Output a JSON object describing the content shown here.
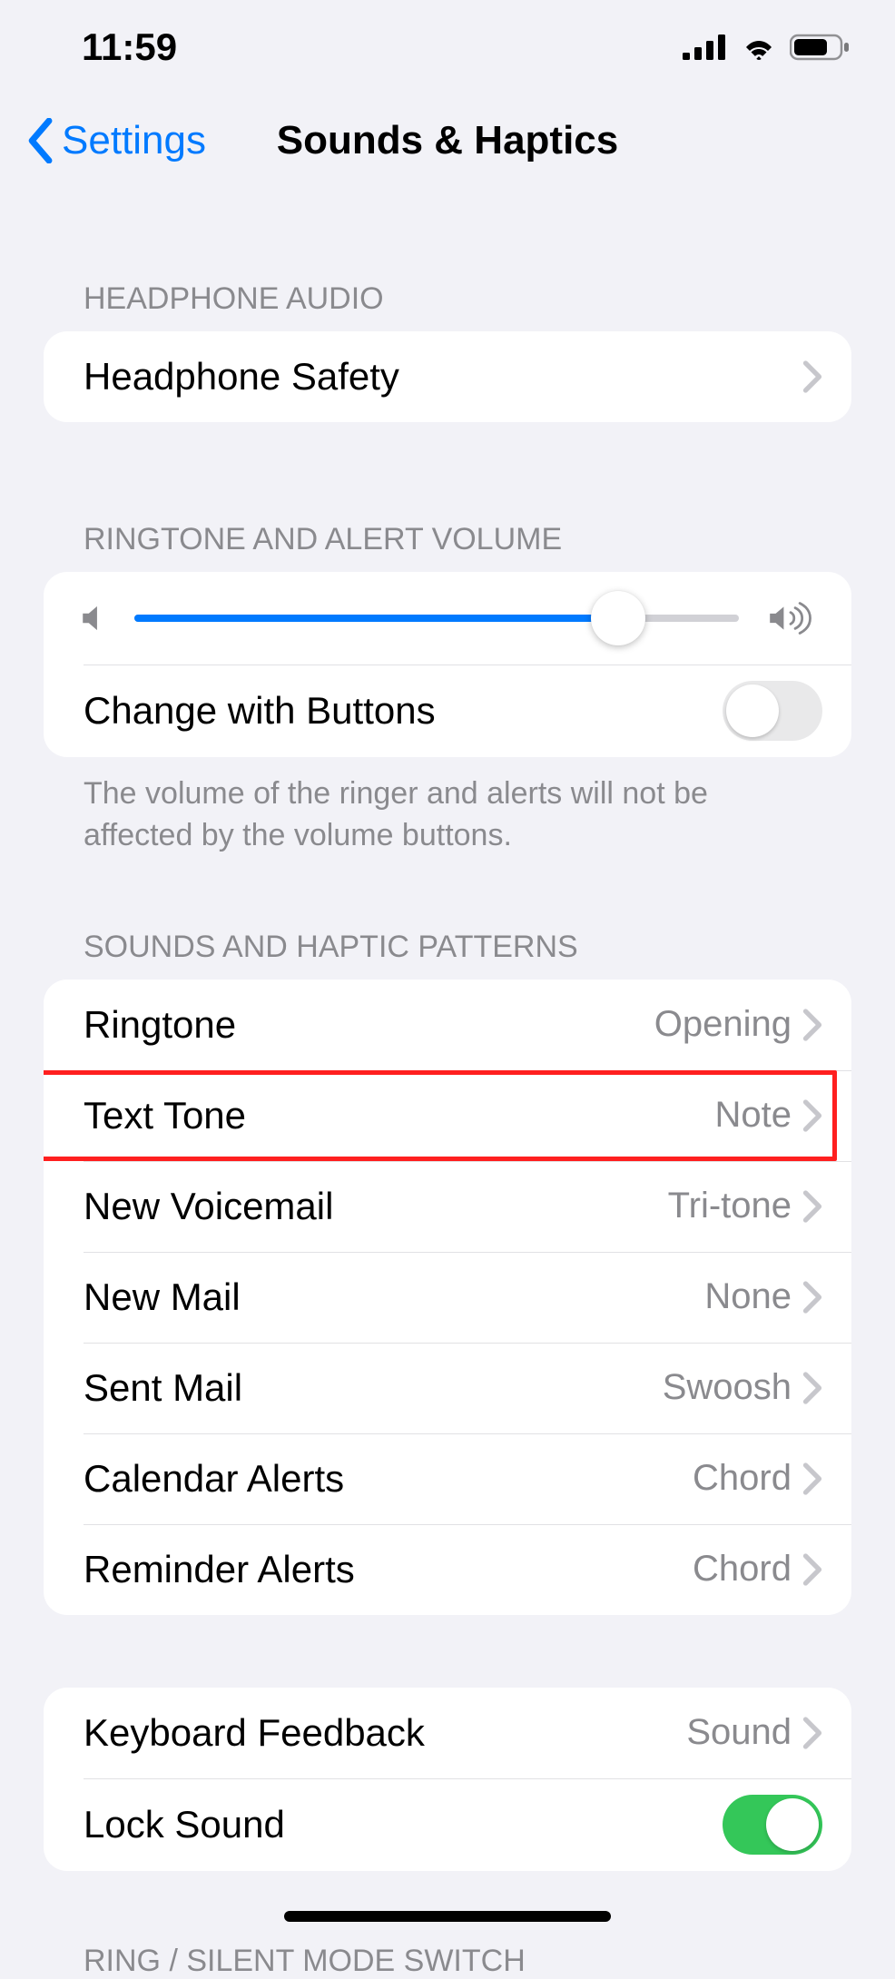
{
  "statusbar": {
    "time": "11:59"
  },
  "nav": {
    "back_label": "Settings",
    "title": "Sounds & Haptics"
  },
  "sections": {
    "headphone": {
      "header": "HEADPHONE AUDIO",
      "safety_label": "Headphone Safety"
    },
    "volume": {
      "header": "RINGTONE AND ALERT VOLUME",
      "slider_percent": 80,
      "change_with_buttons_label": "Change with Buttons",
      "change_with_buttons_on": false,
      "footer": "The volume of the ringer and alerts will not be affected by the volume buttons."
    },
    "patterns": {
      "header": "SOUNDS AND HAPTIC PATTERNS",
      "items": [
        {
          "label": "Ringtone",
          "value": "Opening"
        },
        {
          "label": "Text Tone",
          "value": "Note",
          "highlighted": true
        },
        {
          "label": "New Voicemail",
          "value": "Tri-tone"
        },
        {
          "label": "New Mail",
          "value": "None"
        },
        {
          "label": "Sent Mail",
          "value": "Swoosh"
        },
        {
          "label": "Calendar Alerts",
          "value": "Chord"
        },
        {
          "label": "Reminder Alerts",
          "value": "Chord"
        }
      ]
    },
    "feedback": {
      "keyboard_label": "Keyboard Feedback",
      "keyboard_value": "Sound",
      "lock_label": "Lock Sound",
      "lock_on": true
    },
    "ring_silent": {
      "header": "RING / SILENT MODE SWITCH"
    }
  }
}
